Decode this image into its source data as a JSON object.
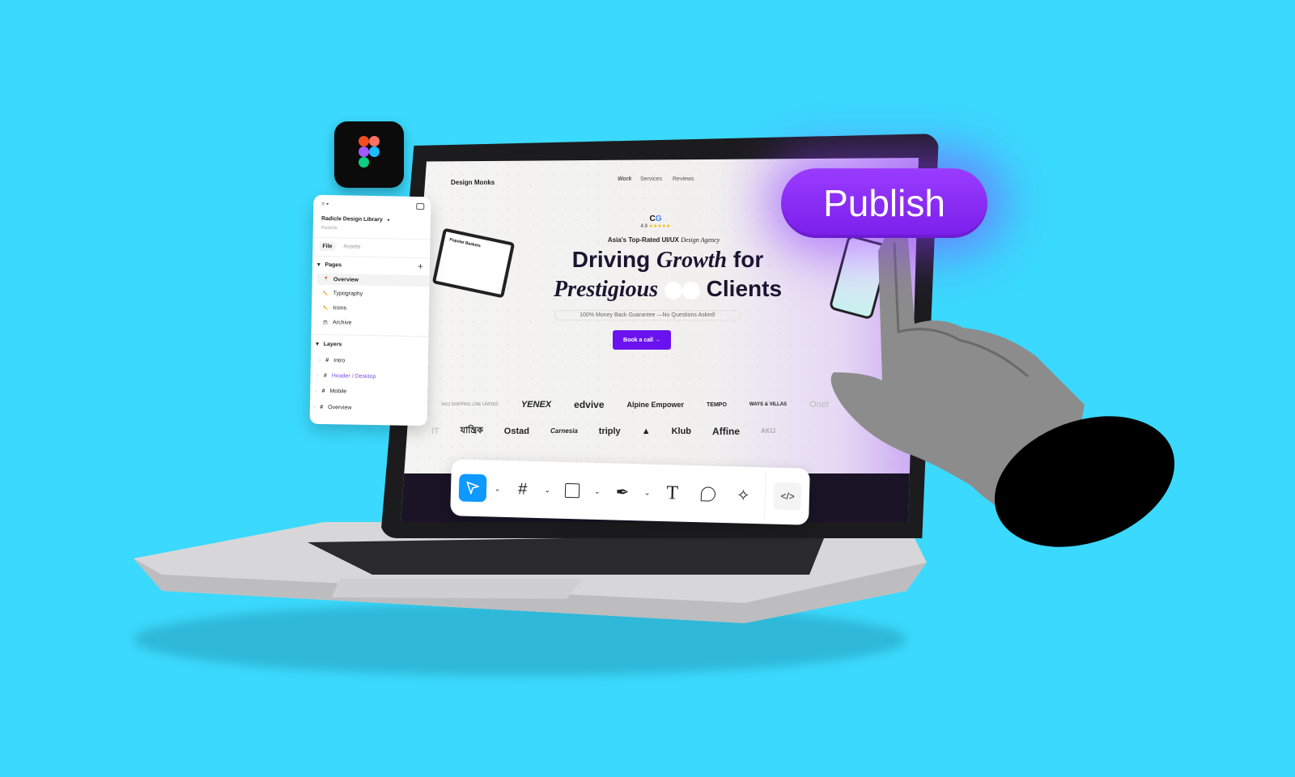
{
  "colors": {
    "background": "#3bd9fd",
    "accent": "#7a1eea",
    "cta": "#6a13f0",
    "tool_active": "#0d99ff"
  },
  "website": {
    "brand": "Design Monks",
    "nav": [
      "Work",
      "Services",
      "Reviews"
    ],
    "rating": "4.9",
    "stars": 5,
    "tagline_a": "Asia's Top-Rated UI/UX",
    "tagline_b": "Design Agency",
    "headline_1a": "Driving",
    "headline_1b": "Growth",
    "headline_1c": "for",
    "headline_2a": "Prestigious",
    "headline_2b": "Clients",
    "guarantee": "100% Money Back Guarantee —No Questions Asked!",
    "cta": "Book a call →",
    "mockup_title": "Popular Baskets",
    "logos_row1": [
      "AKIJ SHIPPING LINE LIMITED",
      "YENEX",
      "edvive",
      "Alpine Empower",
      "TEMPO",
      "WAYS & VILLAS",
      "Onet"
    ],
    "logos_row2": [
      "IT",
      "যান্ত্রিক",
      "Ostad",
      "Carnesia",
      "triply",
      "▲",
      "Klub",
      "Affine",
      "AKIJ"
    ]
  },
  "figma_panel": {
    "file_name": "Radicle Design Library",
    "team": "Radicle",
    "tabs": [
      "File",
      "Assets"
    ],
    "pages_label": "Pages",
    "pages": [
      {
        "icon": "📍",
        "label": "Overview"
      },
      {
        "icon": "✏️",
        "label": "Typography"
      },
      {
        "icon": "✏️",
        "label": "Icons"
      },
      {
        "icon": "🗃",
        "label": "Archive"
      }
    ],
    "layers_label": "Layers",
    "layers": [
      "Intro",
      "Header / Desktop",
      "Mobile",
      "Overview"
    ]
  },
  "toolbar": {
    "tools": [
      "move-icon",
      "frame-icon",
      "rectangle-icon",
      "pen-icon",
      "text-icon",
      "comment-icon",
      "actions-icon",
      "code-icon"
    ],
    "active": "move-icon"
  },
  "publish_label": "Publish"
}
